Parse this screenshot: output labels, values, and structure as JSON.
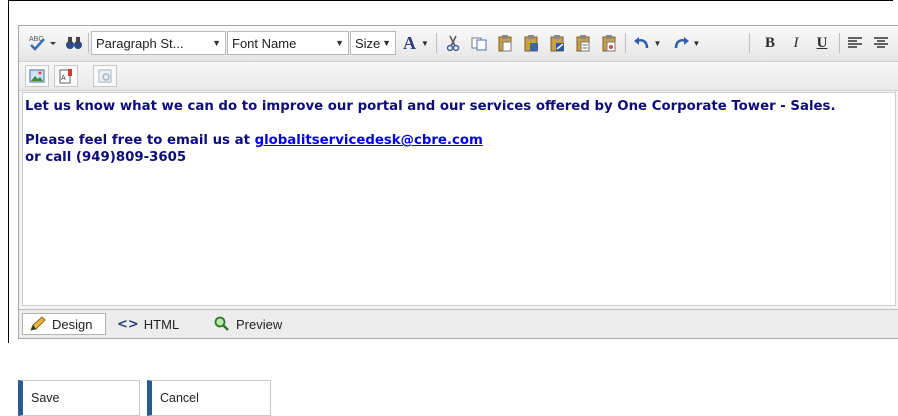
{
  "toolbar": {
    "paragraph_style": "Paragraph St...",
    "font_name": "Font Name",
    "size": "Size",
    "font_color_glyph": "A",
    "bold": "B",
    "italic": "I",
    "underline": "U"
  },
  "content": {
    "line1": "Let us know what we can do to improve our portal and our services offered by One Corporate Tower - Sales.",
    "line2_prefix": "Please feel free to email us at ",
    "email": "globalitservicedesk@cbre.com",
    "line3": "or call (949)809-3605"
  },
  "tabs": [
    {
      "label": "Design",
      "icon": "pencil-icon",
      "active": true
    },
    {
      "label": "HTML",
      "icon": "code-brackets-icon",
      "active": false
    },
    {
      "label": "Preview",
      "icon": "magnifier-icon",
      "active": false
    }
  ],
  "buttons": {
    "save": "Save",
    "cancel": "Cancel"
  },
  "colors": {
    "content_text": "#0d0d7a",
    "link": "#0000ee",
    "button_accent": "#2a5b90"
  }
}
